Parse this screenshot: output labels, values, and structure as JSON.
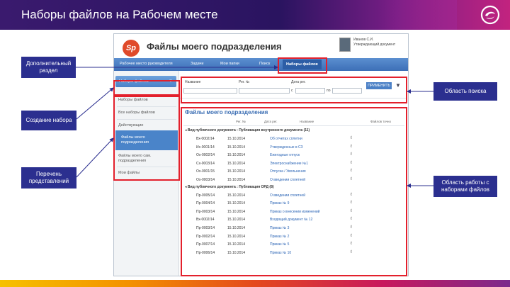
{
  "slide": {
    "title": "Наборы файлов на Рабочем месте",
    "colors": {
      "brand_dark": "#2a1460",
      "brand_magenta": "#c2237f",
      "callout": "#2b2f8f",
      "highlight": "#e3202c"
    }
  },
  "callouts": {
    "extra_section": "Дополнительный раздел",
    "create_set": "Создание набора",
    "views_list": "Перечень представлений",
    "search_area": "Область поиска",
    "work_area": "Область работы с наборами файлов"
  },
  "app": {
    "logo": "Sp",
    "title": "Файлы моего подразделения",
    "user_name": "Иванов С.И.",
    "user_role": "Утверждающий документ",
    "nav": [
      {
        "label": "Рабочее место руководителя"
      },
      {
        "label": "Задачи"
      },
      {
        "label": "Мои папки"
      },
      {
        "label": "Поиск"
      },
      {
        "label": "Наборы файлов"
      }
    ],
    "sidebar": {
      "selector_label": "Наборы файлов",
      "items": [
        "Наборы файлов",
        "Все наборы файлов",
        "Действующие",
        "Файлы моего подразделения",
        "Файлы моего сам. подразделения",
        "Мои файлы"
      ]
    },
    "search": {
      "label_name": "Название",
      "label_reg": "Рег. №",
      "label_date": "Дата рег.",
      "date_from": "с",
      "date_to": "по",
      "apply": "ПРИМЕНИТЬ",
      "funnel_icon": "funnel-icon"
    },
    "work": {
      "title": "Файлы моего подразделения",
      "columns": [
        "Рег. №",
        "Дата рег.",
        "Название",
        "Файлов точно"
      ],
      "groups": [
        {
          "label": "◂ Вид публичного документа : Публикация внутреннего документа (11)",
          "rows": [
            {
              "reg": "Вх-0002/14",
              "date": "15.10.2014",
              "name": "Об отчетах сплетни"
            },
            {
              "reg": "Ис-0001/14",
              "date": "15.10.2014",
              "name": "Утвержденные в СЗ"
            },
            {
              "reg": "Ох-0002/14",
              "date": "15.10.2014",
              "name": "Ежегодные отпуск"
            },
            {
              "reg": "Сх-0003/14",
              "date": "15.10.2014",
              "name": "Электроснабжение №1"
            },
            {
              "reg": "Ох-0001/15",
              "date": "15.10.2014",
              "name": "Отпуска / Увольнения"
            },
            {
              "reg": "Ох-0003/14",
              "date": "15.10.2014",
              "name": "О введении сплетней"
            }
          ]
        },
        {
          "label": "◂ Вид публичного документа : Публикация ОРД (8)",
          "rows": [
            {
              "reg": "Пр-0005/14",
              "date": "15.10.2014",
              "name": "О введении сплетней"
            },
            {
              "reg": "Пр-0004/14",
              "date": "15.10.2014",
              "name": "Приказ № 9"
            },
            {
              "reg": "Пр-0003/14",
              "date": "15.10.2014",
              "name": "Приказ о внесении изменений"
            },
            {
              "reg": "Вх-0002/14",
              "date": "15.10.2014",
              "name": "Входящий документ № 12"
            },
            {
              "reg": "Пр-0003/14",
              "date": "15.10.2014",
              "name": "Приказ № 3"
            },
            {
              "reg": "Пр-0002/14",
              "date": "15.10.2014",
              "name": "Приказ № 2"
            },
            {
              "reg": "Пр-0007/14",
              "date": "15.10.2014",
              "name": "Приказ № 5"
            },
            {
              "reg": "Пр-0006/14",
              "date": "15.10.2014",
              "name": "Приказ № 10"
            }
          ]
        }
      ]
    }
  }
}
